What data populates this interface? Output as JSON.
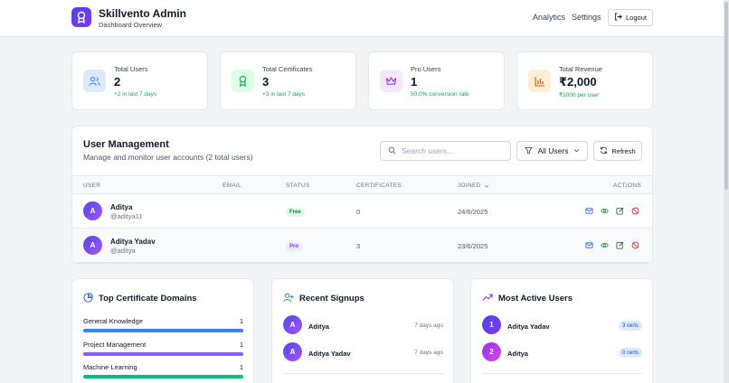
{
  "header": {
    "title": "Skillvento Admin",
    "subtitle": "Dashboard Overview",
    "nav": {
      "analytics": "Analytics",
      "settings": "Settings"
    },
    "logout_label": "Logout"
  },
  "stats": [
    {
      "label": "Total Users",
      "value": "2",
      "sub": "+2 in last 7 days",
      "icon": "users-icon",
      "color": "#3b82f6",
      "bg": "#dbeafe"
    },
    {
      "label": "Total Certificates",
      "value": "3",
      "sub": "+3 in last 7 days",
      "icon": "award-icon",
      "color": "#16a34a",
      "bg": "#dcfce7"
    },
    {
      "label": "Pro Users",
      "value": "1",
      "sub": "50.0% conversion rate",
      "icon": "crown-icon",
      "color": "#9333ea",
      "bg": "#f3e8ff"
    },
    {
      "label": "Total Revenue",
      "value": "₹2,000",
      "sub": "₹1000 per user",
      "icon": "bar-chart-icon",
      "color": "#ea580c",
      "bg": "#ffedd5"
    }
  ],
  "user_management": {
    "title": "User Management",
    "subtitle": "Manage and monitor user accounts (2 total users)",
    "search_placeholder": "Search users...",
    "filter_label": "All Users",
    "refresh_label": "Refresh",
    "columns": {
      "user": "USER",
      "email": "EMAIL",
      "status": "STATUS",
      "certificates": "CERTIFICATES",
      "joined": "JOINED",
      "actions": "ACTIONS"
    },
    "rows": [
      {
        "initial": "A",
        "name": "Aditya",
        "handle": "@aditya11",
        "email": "",
        "status": "Free",
        "certificates": "0",
        "joined": "24/6/2025"
      },
      {
        "initial": "A",
        "name": "Aditya Yadav",
        "handle": "@aditya",
        "email": "",
        "status": "Pro",
        "certificates": "3",
        "joined": "23/6/2025"
      }
    ]
  },
  "top_domains": {
    "title": "Top Certificate Domains",
    "items": [
      {
        "label": "General Knowledge",
        "count": "1",
        "fill": 1.0,
        "color": "#3b82f6"
      },
      {
        "label": "Project Management",
        "count": "1",
        "fill": 1.0,
        "color": "#8b5cf6"
      },
      {
        "label": "Machine Learning",
        "count": "1",
        "fill": 1.0,
        "color": "#10b981"
      }
    ]
  },
  "recent_signups": {
    "title": "Recent Signups",
    "items": [
      {
        "initial": "A",
        "name": "Aditya",
        "time": "7 days ago"
      },
      {
        "initial": "A",
        "name": "Aditya Yadav",
        "time": "7 days ago"
      }
    ]
  },
  "most_active": {
    "title": "Most Active Users",
    "items": [
      {
        "rank": "1",
        "name": "Aditya Yadav",
        "certs": "3 certs"
      },
      {
        "rank": "2",
        "name": "Aditya",
        "certs": "0 certs"
      }
    ]
  }
}
